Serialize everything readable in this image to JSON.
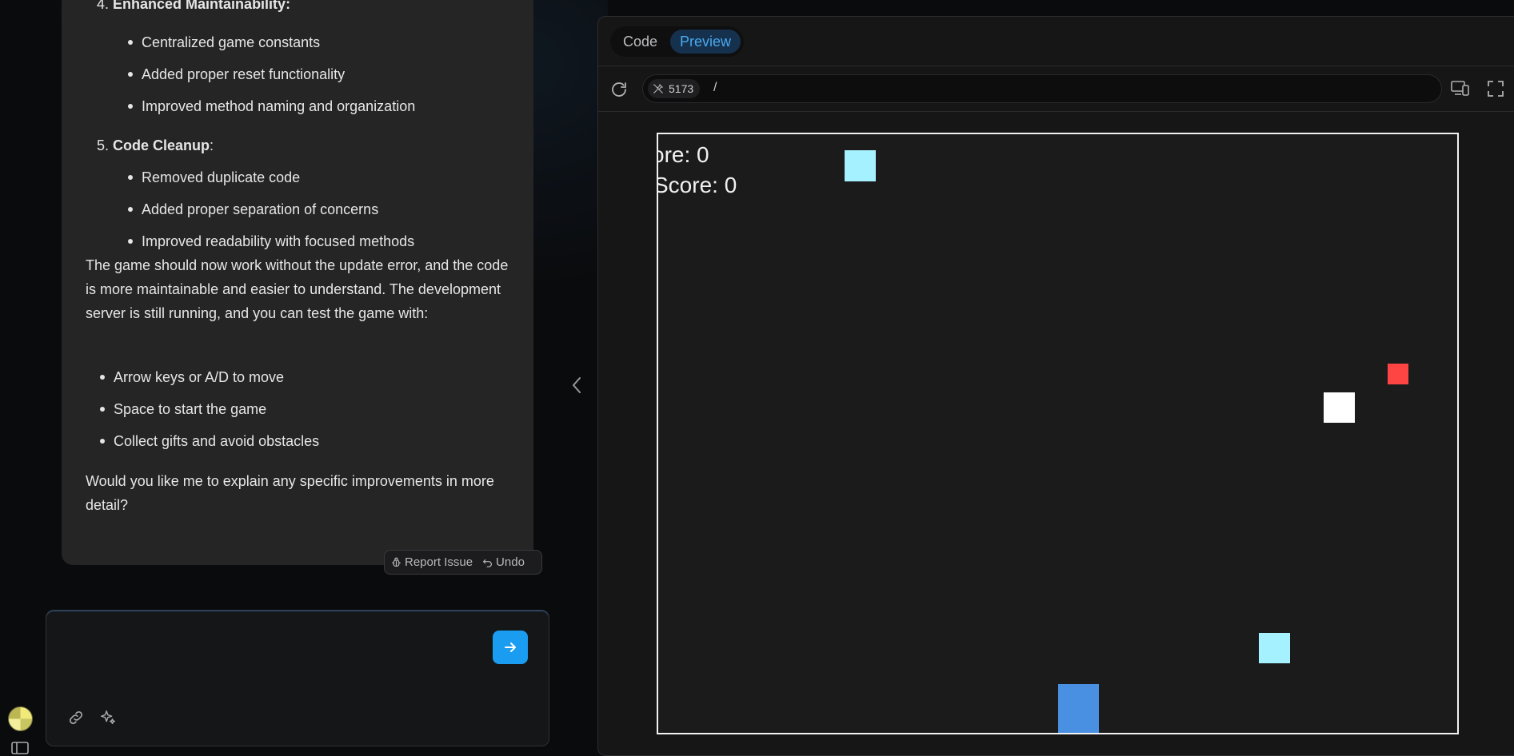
{
  "chat": {
    "item4": {
      "number": "4.",
      "title": "Enhanced Maintainability",
      "colon": ":"
    },
    "item4_bullets": [
      "Centralized game constants",
      "Added proper reset functionality",
      "Improved method naming and organization"
    ],
    "item5": {
      "number": "5.",
      "title": "Code Cleanup",
      "colon": ":"
    },
    "item5_bullets": [
      "Removed duplicate code",
      "Added proper separation of concerns",
      "Improved readability with focused methods"
    ],
    "paragraph1": "The game should now work without the update error, and the code is more maintainable and easier to understand. The development server is still running, and you can test the game with:",
    "controls": [
      "Arrow keys or A/D to move",
      "Space to start the game",
      "Collect gifts and avoid obstacles"
    ],
    "paragraph2": "Would you like me to explain any specific improvements in more detail?",
    "actions": {
      "report": "Report Issue",
      "undo": "Undo"
    }
  },
  "input": {
    "placeholder": "",
    "value": ""
  },
  "preview": {
    "tabs": [
      {
        "label": "Code",
        "active": false
      },
      {
        "label": "Preview",
        "active": true
      }
    ],
    "port": "5173",
    "path": "/"
  },
  "game": {
    "score_line": "ore: 0",
    "high_score_line": "Score: 0"
  },
  "colors": {
    "accent": "#1a9cf0",
    "gift": "#a6f1ff",
    "obstacle": "#ff4444",
    "player": "#4a90e2",
    "snow": "#ffffff"
  },
  "icons": {
    "report": "bug-icon",
    "undo": "undo-icon",
    "send": "arrow-right-icon",
    "link": "link-icon",
    "sparkle": "sparkle-icon",
    "reload": "reload-icon",
    "port": "plug-icon",
    "devices": "devices-icon",
    "fullscreen": "fullscreen-icon",
    "chevron": "chevron-left-icon",
    "sidebar": "sidebar-icon"
  }
}
